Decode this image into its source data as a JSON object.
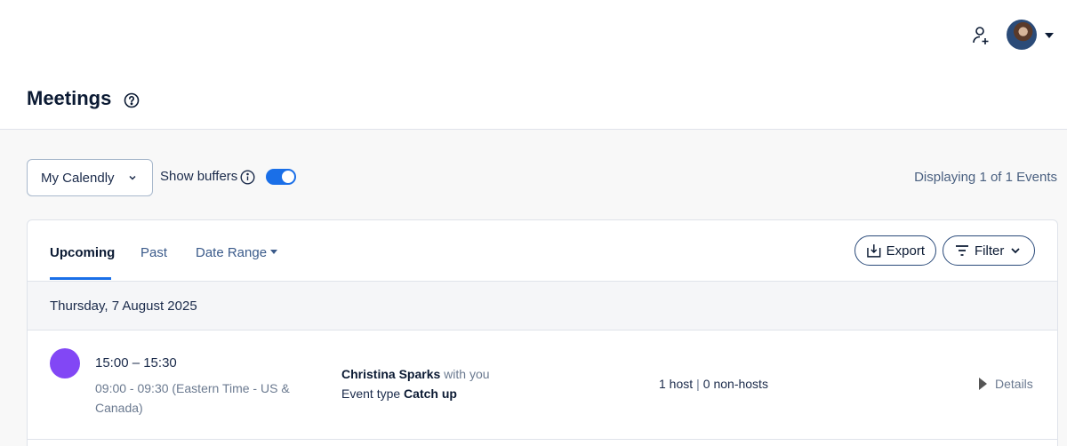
{
  "header": {
    "page_title": "Meetings",
    "icons": {
      "add_user": "add-user-icon",
      "help": "help-circle-icon",
      "avatar_caret": "caret-down-icon"
    }
  },
  "toolbar": {
    "calendar_select_value": "My Calendly",
    "show_buffers_label": "Show buffers",
    "show_buffers_on": true,
    "displaying_text": "Displaying 1 of 1 Events"
  },
  "tabs": [
    {
      "label": "Upcoming",
      "active": true
    },
    {
      "label": "Past",
      "active": false
    },
    {
      "label": "Date Range",
      "active": false
    }
  ],
  "actions": {
    "export_label": "Export",
    "filter_label": "Filter"
  },
  "events": {
    "date_heading": "Thursday, 7 August 2025",
    "items": [
      {
        "color": "#8247f5",
        "time": "15:00 – 15:30",
        "alt_time": "09:00 - 09:30 (Eastern Time - US & Canada)",
        "invitee_name": "Christina Sparks",
        "invitee_suffix": "with you",
        "event_type_prefix": "Event type",
        "event_type": "Catch up",
        "hosts": "1 host",
        "non_hosts": "0 non-hosts",
        "details_label": "Details"
      }
    ]
  },
  "colors": {
    "accent": "#1a6fe8",
    "event_purple": "#8247f5",
    "text_dark": "#0b1a33"
  }
}
